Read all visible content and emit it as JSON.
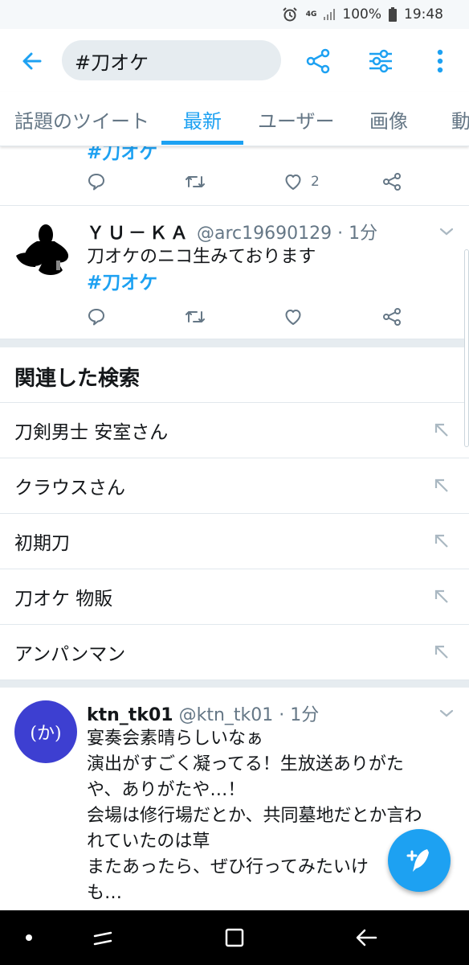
{
  "status_bar": {
    "network": "4G",
    "battery": "100%",
    "time": "19:48"
  },
  "search": {
    "query": "#刀オケ"
  },
  "tabs": [
    {
      "label": "話題のツイート",
      "active": false
    },
    {
      "label": "最新",
      "active": true
    },
    {
      "label": "ユーザー",
      "active": false
    },
    {
      "label": "画像",
      "active": false
    },
    {
      "label": "動",
      "active": false
    }
  ],
  "prev_tweet": {
    "hashtag": "#刀オケ",
    "like_count": "2"
  },
  "tweets": [
    {
      "name": "ＹＵ－ＫＡ",
      "handle": "@arc19690129",
      "time": "1分",
      "text_line1": "刀オケのニコ生みております",
      "hashtag": "#刀オケ"
    },
    {
      "name": "ktn_tk01",
      "handle": "@ktn_tk01",
      "time": "1分",
      "avatar_text": "(か)",
      "lines": [
        "宴奏会素晴らしいなぁ",
        "演出がすごく凝ってる！生放送ありがた",
        "や、ありがたや…！",
        "会場は修行場だとか、共同墓地だとか言わ",
        "れていたのは草",
        "またあったら、ぜひ行ってみたいけ",
        "も…"
      ]
    }
  ],
  "meta_sep": "·",
  "related": {
    "title": "関連した検索",
    "items": [
      "刀剣男士 安室さん",
      "クラウスさん",
      "初期刀",
      "刀オケ 物販",
      "アンパンマン"
    ]
  },
  "colors": {
    "accent": "#1da1f2",
    "secondary_text": "#657786",
    "divider": "#e1e8ed",
    "avatar_purple": "#3d3fd1"
  },
  "icons": [
    "back-arrow-icon",
    "share-icon",
    "filter-icon",
    "more-vertical-icon",
    "reply-icon",
    "retweet-icon",
    "like-icon",
    "share-icon",
    "chevron-down-icon",
    "north-west-arrow-icon",
    "compose-icon"
  ]
}
